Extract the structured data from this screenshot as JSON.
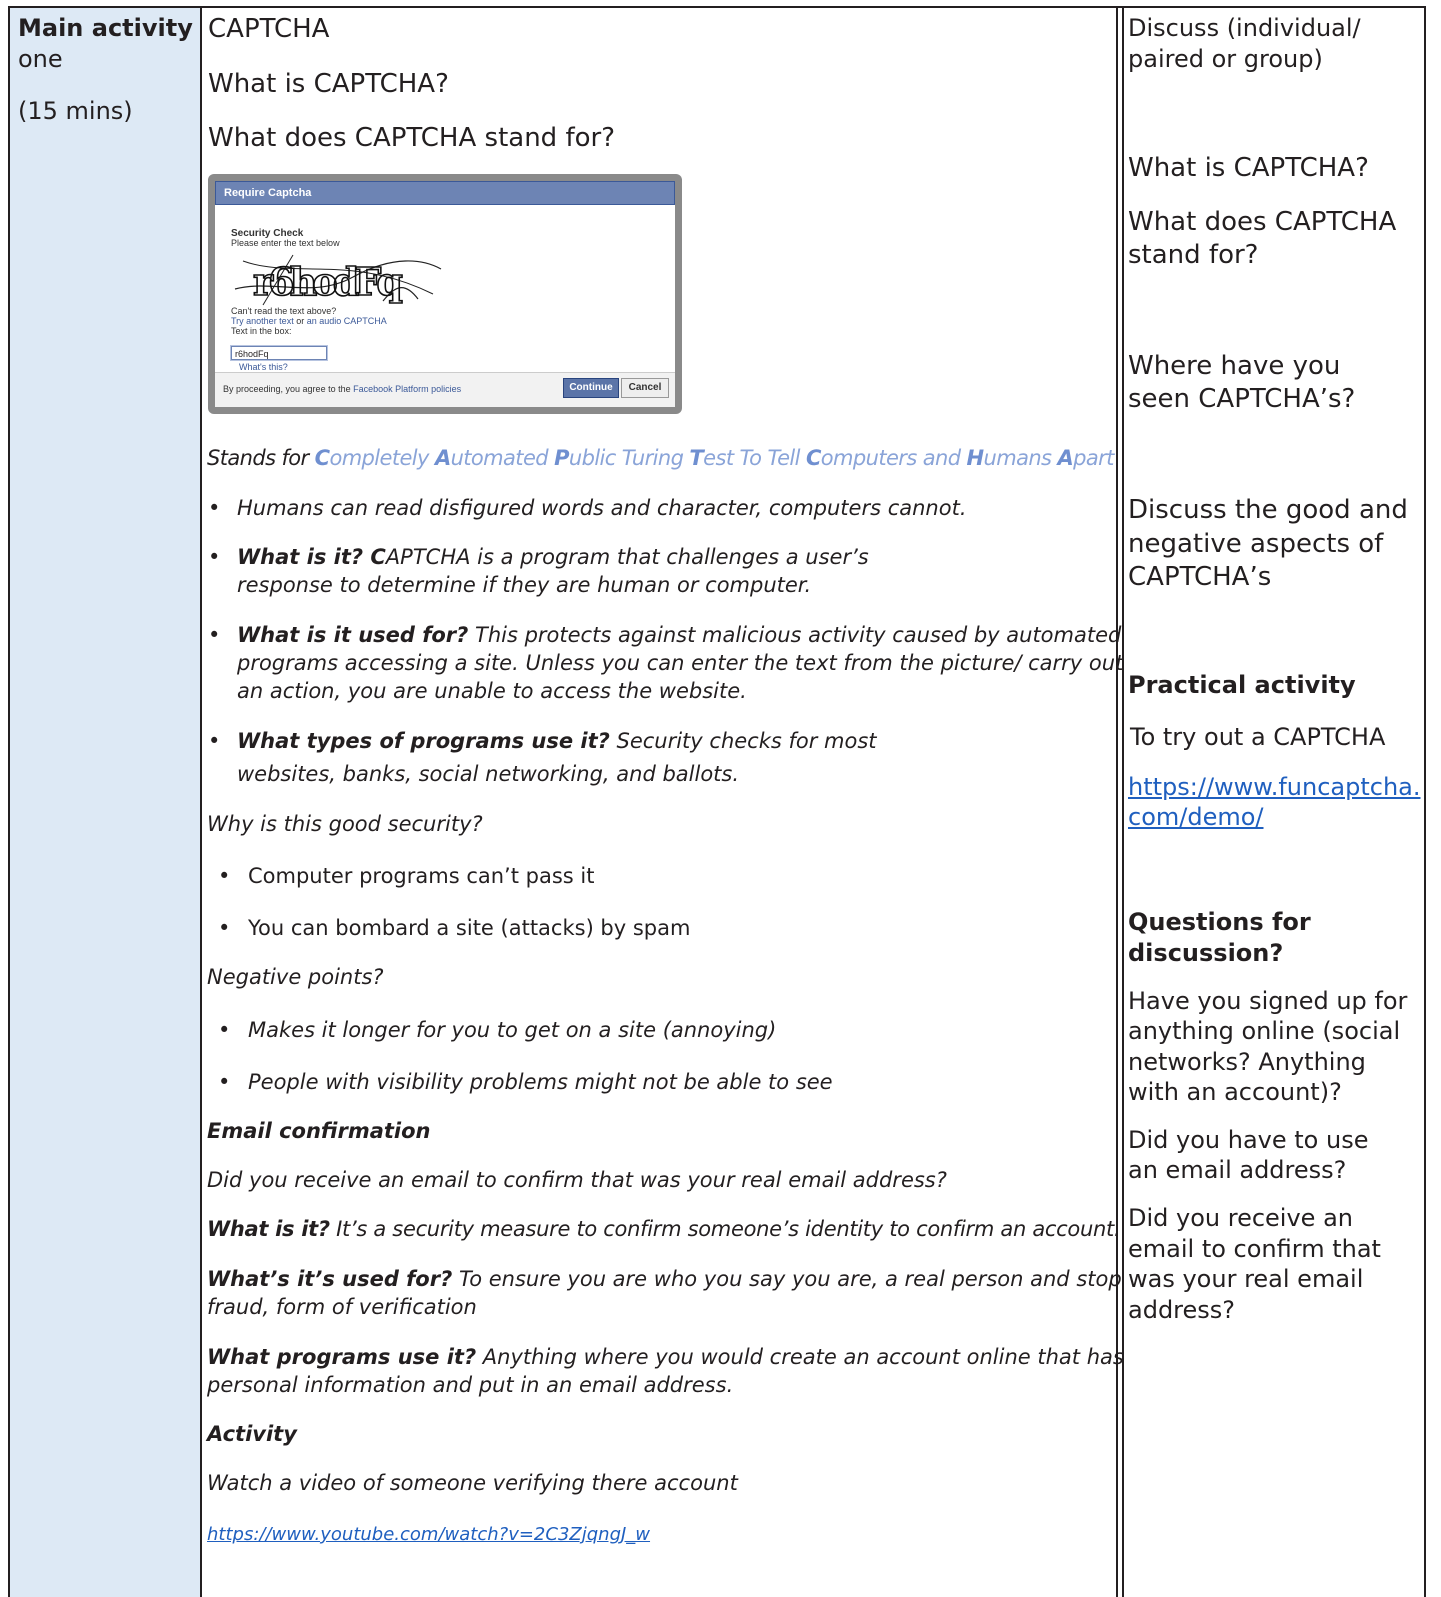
{
  "left": {
    "title": "Main activity",
    "sub": "one",
    "duration": "(15 mins)"
  },
  "main": {
    "heading": "CAPTCHA",
    "q1": "What is CAPTCHA?",
    "q2": "What does CAPTCHA stand for?",
    "captcha": {
      "window_title": "Require Captcha",
      "security_check": "Security Check",
      "please_enter": "Please enter the text below",
      "captcha_text": "r6hodFq",
      "cant_read": "Can't read the text above?",
      "try_another": "Try another text",
      "or": "or",
      "audio": "an audio CAPTCHA",
      "text_in_box": "Text in the box:",
      "input_value": "r6hodFq",
      "whats_this": "What's this?",
      "proceeding": "By proceeding, you agree to the",
      "policies": "Facebook Platform policies",
      "continue_label": "Continue",
      "cancel_label": "Cancel"
    },
    "stands_for": {
      "lead": "Stands for ",
      "parts": [
        {
          "cap": "C",
          "rest": "ompletely "
        },
        {
          "cap": "A",
          "rest": "utomated "
        },
        {
          "cap": "P",
          "rest": "ublic Turing "
        },
        {
          "cap": "T",
          "rest": "est To Tell  "
        },
        {
          "cap": "C",
          "rest": "omputers and "
        },
        {
          "cap": "H",
          "rest": "umans "
        },
        {
          "cap": "A",
          "rest": "part"
        }
      ]
    },
    "bullets": {
      "b1": "Humans can read disfigured words and character, computers cannot.",
      "b2_bold": "What is it? C",
      "b2_l1": "APTCHA is a program that challenges a user’s",
      "b2_l2": "response to determine if they are human or computer.",
      "b3_bold": "What is it used for?",
      "b3_l1": " This protects against malicious activity caused by automated",
      "b3_l2": "programs accessing a site. Unless you can enter the text from the picture/ carry out",
      "b3_l3": "an action, you are unable to access the website.",
      "b4_bold": "What types of programs use it?",
      "b4_l1": " Security checks for most",
      "b4_l2": "websites, banks, social networking, and ballots."
    },
    "why_good": "Why is this good security?",
    "good_points": [
      "Computer programs can’t pass it",
      "You can bombard a site (attacks) by spam"
    ],
    "negative": "Negative points?",
    "negative_points": [
      "Makes it longer for you to get on a site (annoying)",
      "People with visibility problems might not be able to see"
    ],
    "email_heading": "Email confirmation",
    "email_q": "Did you receive an email to confirm that was your real email address?",
    "email_what_bold": "What is it?",
    "email_what": " It’s a security measure to confirm someone’s identity to confirm an account.",
    "email_used_bold": "What’s it’s used for?",
    "email_used_l1": "  To ensure you are who you say you are, a real person and stop",
    "email_used_l2": "fraud, form of verification",
    "email_prog_bold": "What programs use it?",
    "email_prog_l1": " Anything where you would create an account online that has",
    "email_prog_l2": "personal information and put in an email address.",
    "activity_heading": "Activity",
    "activity_text": "Watch a video of someone verifying there account",
    "activity_link": "https://www.youtube.com/watch?v=2C3ZjqngJ_w"
  },
  "right": {
    "discuss_l1": "Discuss (individual/",
    "discuss_l2": "paired or group)",
    "q1": "What is CAPTCHA?",
    "q2_l1": "What does CAPTCHA",
    "q2_l2": "stand for?",
    "q3_l1": "Where have you",
    "q3_l2": "seen CAPTCHA’s?",
    "q4_l1": "Discuss the good and",
    "q4_l2": "negative aspects of",
    "q4_l3": "CAPTCHA’s",
    "practical": "Practical activity",
    "try_out": "To try out a CAPTCHA",
    "link_l1": "https://www.funcaptcha.",
    "link_l2": "com/demo/",
    "questions_l1": "Questions for",
    "questions_l2": "discussion?",
    "d1_l1": "Have you signed up for",
    "d1_l2": "anything online (social",
    "d1_l3": "networks? Anything",
    "d1_l4": "with an account)?",
    "d2_l1": "Did you have to use",
    "d2_l2": "an email address?",
    "d3_l1": "Did you receive an",
    "d3_l2": "email to confirm that",
    "d3_l3": "was your real email",
    "d3_l4": "address?"
  }
}
